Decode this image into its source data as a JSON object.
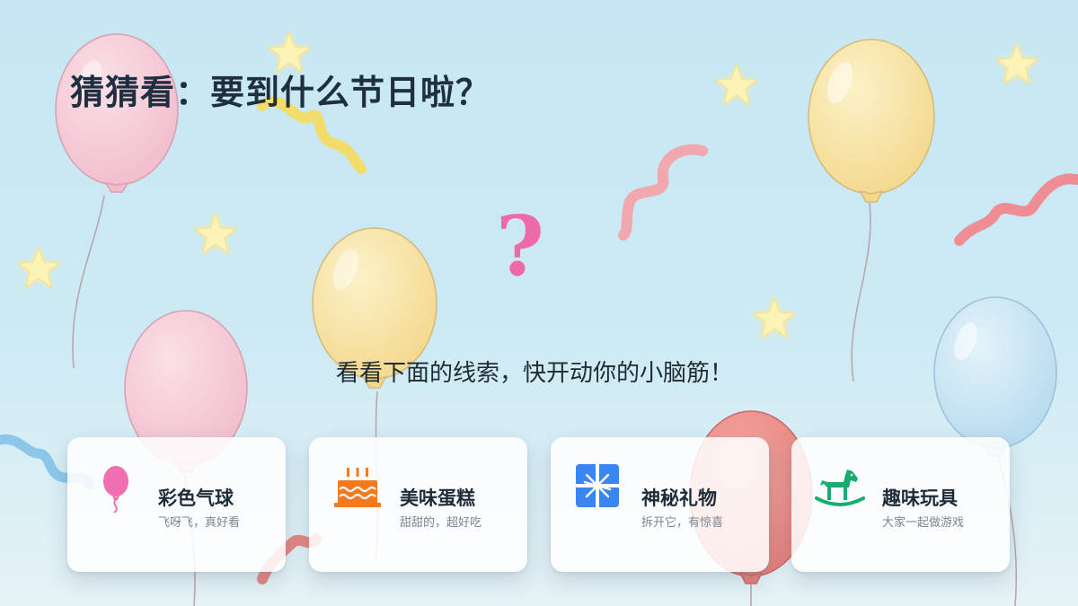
{
  "slide": {
    "title": "猜猜看：要到什么节日啦？",
    "question_mark": "?",
    "subtitle": "看看下面的线索，快开动你的小脑筋！"
  },
  "clues": [
    {
      "icon": "balloon-icon",
      "title": "彩色气球",
      "subtitle": "飞呀飞，真好看",
      "color": "#f06fb0"
    },
    {
      "icon": "cake-icon",
      "title": "美味蛋糕",
      "subtitle": "甜甜的，超好吃",
      "color": "#f47a1f"
    },
    {
      "icon": "gift-icon",
      "title": "神秘礼物",
      "subtitle": "拆开它，有惊喜",
      "color": "#3a86f0"
    },
    {
      "icon": "rocking-horse-icon",
      "title": "趣味玩具",
      "subtitle": "大家一起做游戏",
      "color": "#1aab6e"
    }
  ],
  "colors": {
    "background": "#c6e7f3",
    "title": "#1f2f40",
    "question_mark": "#ee6aa7",
    "balloon_pink": "#f6c6d3",
    "balloon_yellow": "#f7e3a0",
    "balloon_blue": "#c6e3f1",
    "balloon_red": "#ec8a85",
    "star": "#fdf3b6"
  }
}
